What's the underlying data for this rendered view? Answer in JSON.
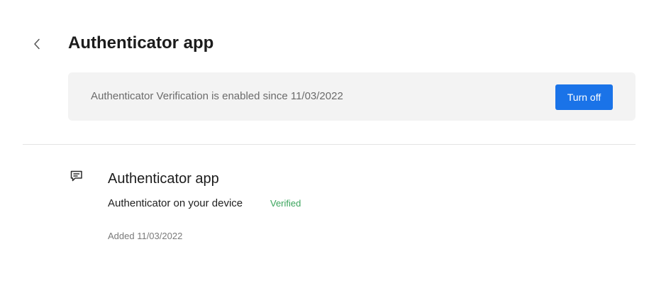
{
  "header": {
    "title": "Authenticator app",
    "back_icon": "chevron-left-icon"
  },
  "banner": {
    "text": "Authenticator Verification is enabled since 11/03/2022",
    "button_label": "Turn off",
    "accent_color": "#1a73e8"
  },
  "method": {
    "icon": "message-icon",
    "title": "Authenticator app",
    "description": "Authenticator on your device",
    "status": "Verified",
    "status_color": "#3aa45c",
    "added": "Added 11/03/2022"
  }
}
